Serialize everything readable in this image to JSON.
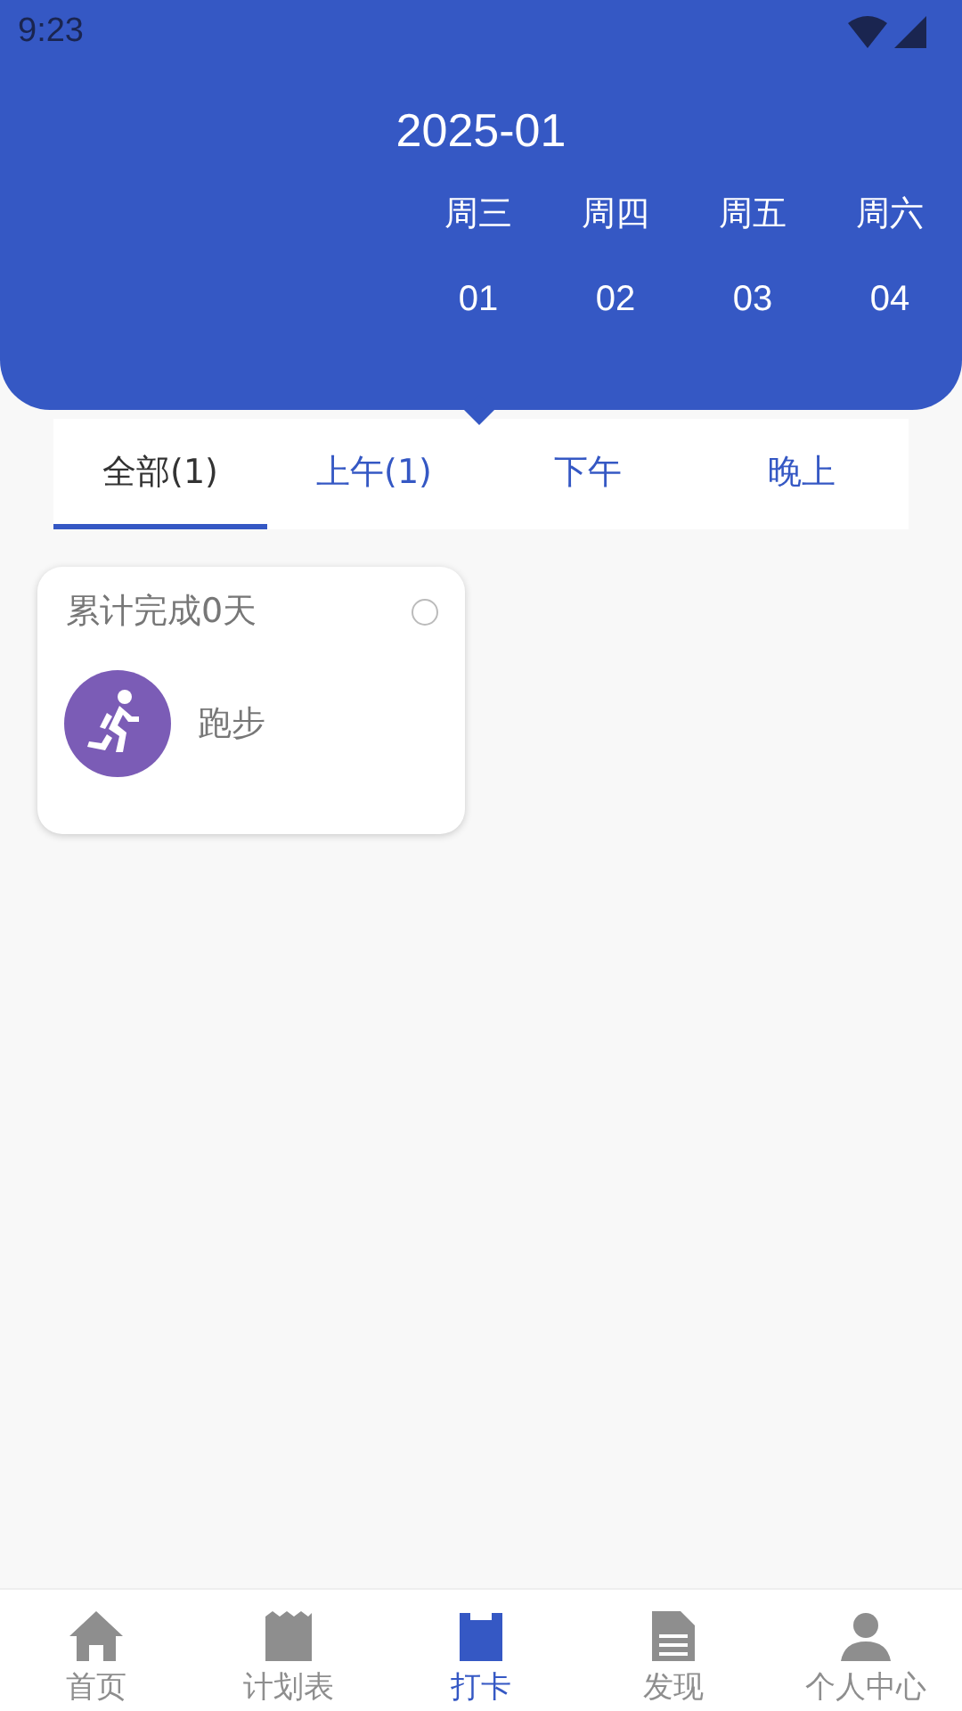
{
  "status_bar": {
    "time": "9:23"
  },
  "header": {
    "month": "2025-01",
    "days": [
      {
        "weekday": "周三",
        "date": "01",
        "selected": true
      },
      {
        "weekday": "周四",
        "date": "02",
        "selected": false
      },
      {
        "weekday": "周五",
        "date": "03",
        "selected": false
      },
      {
        "weekday": "周六",
        "date": "04",
        "selected": false
      }
    ]
  },
  "tabs": [
    {
      "label": "全部(1)",
      "selected": true
    },
    {
      "label": "上午(1)",
      "selected": false
    },
    {
      "label": "下午",
      "selected": false
    },
    {
      "label": "晚上",
      "selected": false
    }
  ],
  "habits": [
    {
      "summary": "累计完成0天",
      "name": "跑步",
      "checked": false
    }
  ],
  "bottom_nav": [
    {
      "label": "首页",
      "kind": "home",
      "selected": false
    },
    {
      "label": "计划表",
      "kind": "plan",
      "selected": false
    },
    {
      "label": "打卡",
      "kind": "checkin",
      "selected": true
    },
    {
      "label": "发现",
      "kind": "discover",
      "selected": false
    },
    {
      "label": "个人中心",
      "kind": "profile",
      "selected": false
    }
  ]
}
